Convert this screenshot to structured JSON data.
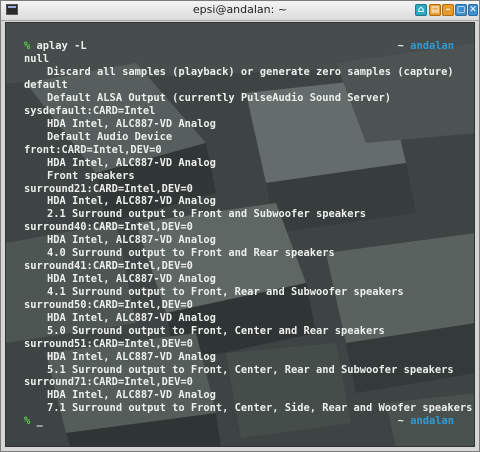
{
  "window": {
    "title": "epsi@andalan: ~",
    "buttons": [
      {
        "name": "sticky-icon",
        "glyph": "⌂"
      },
      {
        "name": "shade-icon",
        "glyph": "▤"
      },
      {
        "name": "minimize-icon",
        "glyph": "–"
      },
      {
        "name": "maximize-icon",
        "glyph": "▢"
      },
      {
        "name": "close-icon",
        "glyph": "✕"
      }
    ]
  },
  "terminal": {
    "prompt_symbol": "%",
    "command": "aplay -L",
    "right_prompt_tilde": "~",
    "right_prompt_host": "andalan",
    "cursor": "_",
    "output": [
      {
        "text": "null",
        "indent": false
      },
      {
        "text": "Discard all samples (playback) or generate zero samples (capture)",
        "indent": true
      },
      {
        "text": "default",
        "indent": false
      },
      {
        "text": "Default ALSA Output (currently PulseAudio Sound Server)",
        "indent": true
      },
      {
        "text": "sysdefault:CARD=Intel",
        "indent": false
      },
      {
        "text": "HDA Intel, ALC887-VD Analog",
        "indent": true
      },
      {
        "text": "Default Audio Device",
        "indent": true
      },
      {
        "text": "front:CARD=Intel,DEV=0",
        "indent": false
      },
      {
        "text": "HDA Intel, ALC887-VD Analog",
        "indent": true
      },
      {
        "text": "Front speakers",
        "indent": true
      },
      {
        "text": "surround21:CARD=Intel,DEV=0",
        "indent": false
      },
      {
        "text": "HDA Intel, ALC887-VD Analog",
        "indent": true
      },
      {
        "text": "2.1 Surround output to Front and Subwoofer speakers",
        "indent": true
      },
      {
        "text": "surround40:CARD=Intel,DEV=0",
        "indent": false
      },
      {
        "text": "HDA Intel, ALC887-VD Analog",
        "indent": true
      },
      {
        "text": "4.0 Surround output to Front and Rear speakers",
        "indent": true
      },
      {
        "text": "surround41:CARD=Intel,DEV=0",
        "indent": false
      },
      {
        "text": "HDA Intel, ALC887-VD Analog",
        "indent": true
      },
      {
        "text": "4.1 Surround output to Front, Rear and Subwoofer speakers",
        "indent": true
      },
      {
        "text": "surround50:CARD=Intel,DEV=0",
        "indent": false
      },
      {
        "text": "HDA Intel, ALC887-VD Analog",
        "indent": true
      },
      {
        "text": "5.0 Surround output to Front, Center and Rear speakers",
        "indent": true
      },
      {
        "text": "surround51:CARD=Intel,DEV=0",
        "indent": false
      },
      {
        "text": "HDA Intel, ALC887-VD Analog",
        "indent": true
      },
      {
        "text": "5.1 Surround output to Front, Center, Rear and Subwoofer speakers",
        "indent": true
      },
      {
        "text": "surround71:CARD=Intel,DEV=0",
        "indent": false
      },
      {
        "text": "HDA Intel, ALC887-VD Analog",
        "indent": true
      },
      {
        "text": "7.1 Surround output to Front, Center, Side, Rear and Woofer speakers",
        "indent": true
      }
    ]
  },
  "colors": {
    "prompt": "#5ec84d",
    "hostname": "#2f9bd6",
    "text": "#ecefec"
  }
}
